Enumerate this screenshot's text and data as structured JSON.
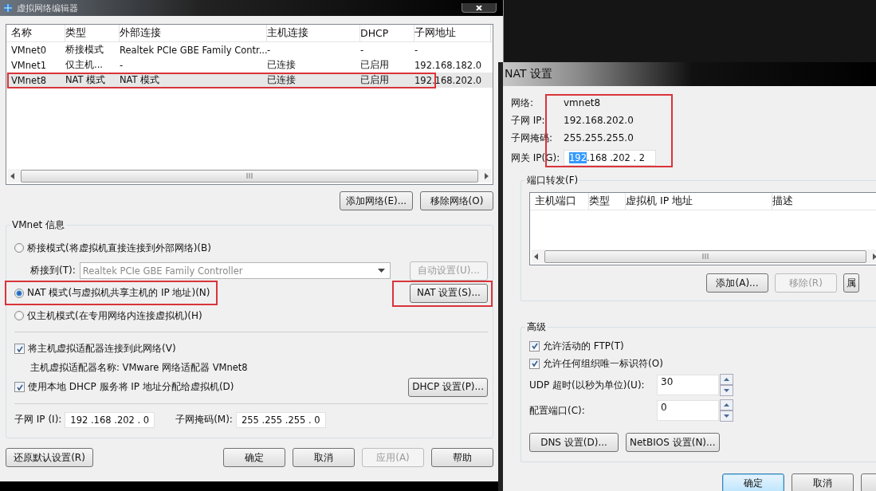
{
  "network_editor": {
    "title": "虚拟网络编辑器",
    "table": {
      "columns": [
        "名称",
        "类型",
        "外部连接",
        "主机连接",
        "DHCP",
        "子网地址"
      ],
      "rows": [
        {
          "cells": [
            "VMnet0",
            "桥接模式",
            "Realtek PCIe GBE Family Contr...",
            "-",
            "-",
            "-"
          ],
          "selected": false,
          "highlighted": false
        },
        {
          "cells": [
            "VMnet1",
            "仅主机...",
            "-",
            "已连接",
            "已启用",
            "192.168.182.0"
          ],
          "selected": false,
          "highlighted": false
        },
        {
          "cells": [
            "VMnet8",
            "NAT 模式",
            "NAT 模式",
            "已连接",
            "已启用",
            "192.168.202.0"
          ],
          "selected": true,
          "highlighted": true
        }
      ]
    },
    "list_buttons": [
      {
        "label": "添加网络(E)...",
        "disabled": false
      },
      {
        "label": "移除网络(O)",
        "disabled": false
      }
    ],
    "vmnet_info": {
      "title": "VMnet 信息",
      "modes": [
        {
          "label": "桥接模式(将虚拟机直接连接到外部网络)(B)",
          "selected": false,
          "highlighted": false
        },
        {
          "label": "NAT 模式(与虚拟机共享主机的 IP 地址)(N)",
          "selected": true,
          "highlighted": true
        },
        {
          "label": "仅主机模式(在专用网络内连接虚拟机)(H)",
          "selected": false,
          "highlighted": false
        }
      ],
      "bridge_to": {
        "label": "桥接到(T):",
        "value": "Realtek PCIe GBE Family Controller",
        "disabled": true
      },
      "auto_button": {
        "label": "自动设置(U)...",
        "disabled": true
      },
      "nat_button": {
        "label": "NAT 设置(S)...",
        "disabled": false,
        "highlighted": true
      },
      "connect_adapter": {
        "label": "将主机虚拟适配器连接到此网络(V)",
        "checked": true
      },
      "adapter_name": "主机虚拟适配器名称: VMware 网络适配器 VMnet8",
      "use_dhcp": {
        "label": "使用本地 DHCP 服务将 IP 地址分配给虚拟机(D)",
        "checked": true
      },
      "dhcp_button": {
        "label": "DHCP 设置(P)...",
        "disabled": false
      },
      "subnet_ip": {
        "label": "子网 IP (I):",
        "value": "192 .168 .202 . 0"
      },
      "subnet_mask": {
        "label": "子网掩码(M):",
        "value": "255 .255 .255 . 0"
      }
    },
    "restore_button": {
      "label": "还原默认设置(R)",
      "disabled": false
    },
    "buttons": [
      {
        "label": "确定",
        "disabled": false
      },
      {
        "label": "取消",
        "disabled": false
      },
      {
        "label": "应用(A)",
        "disabled": true
      },
      {
        "label": "帮助",
        "disabled": false
      }
    ]
  },
  "nat_settings": {
    "title": "NAT 设置",
    "info": {
      "highlighted": true,
      "network": {
        "label": "网络:",
        "value": "vmnet8"
      },
      "subnet_ip": {
        "label": "子网 IP:",
        "value": "192.168.202.0"
      },
      "subnet_mask": {
        "label": "子网掩码:",
        "value": "255.255.255.0"
      },
      "gateway": {
        "label": "网关 IP(G):",
        "segments": [
          {
            "text": "192",
            "selected": true
          },
          {
            "text": ".168 .202 . 2",
            "selected": false
          }
        ]
      }
    },
    "port_forwarding": {
      "title": "端口转发(F)",
      "columns": [
        "主机端口",
        "类型",
        "虚拟机 IP 地址",
        "描述"
      ],
      "buttons": [
        {
          "label": "添加(A)...",
          "disabled": false
        },
        {
          "label": "移除(R)",
          "disabled": true
        },
        {
          "label": "属",
          "disabled": false
        }
      ]
    },
    "advanced": {
      "title": "高级",
      "options": [
        {
          "label": "允许活动的 FTP(T)",
          "checked": true
        },
        {
          "label": "允许任何组织唯一标识符(O)",
          "checked": true
        }
      ],
      "udp_timeout": {
        "label": "UDP 超时(以秒为单位)(U):",
        "value": "30"
      },
      "config_port": {
        "label": "配置端口(C):",
        "value": "0"
      },
      "buttons": [
        {
          "label": "DNS 设置(D)...",
          "disabled": false
        },
        {
          "label": "NetBIOS 设置(N)...",
          "disabled": false
        }
      ]
    },
    "buttons": [
      {
        "label": "确定",
        "disabled": false,
        "default": true
      },
      {
        "label": "取消",
        "disabled": false,
        "default": false
      },
      {
        "disabled": false,
        "default": false
      }
    ]
  }
}
